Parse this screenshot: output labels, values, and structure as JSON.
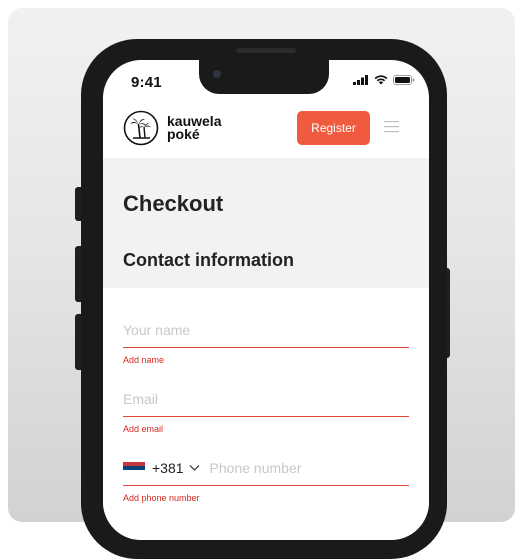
{
  "status_bar": {
    "time": "9:41"
  },
  "header": {
    "logo_line1": "kauwela",
    "logo_line2": "poké",
    "register_label": "Register"
  },
  "page": {
    "title": "Checkout",
    "section_title": "Contact information"
  },
  "form": {
    "name": {
      "placeholder": "Your name",
      "value": "",
      "error": "Add name"
    },
    "email": {
      "placeholder": "Email",
      "value": "",
      "error": "Add email"
    },
    "phone": {
      "country_flag": "serbia-flag",
      "dial_code": "+381",
      "placeholder": "Phone number",
      "value": "",
      "error": "Add phone number"
    }
  },
  "colors": {
    "accent": "#f05b3f",
    "error": "#d7281f",
    "section_bg": "#f2f2f2"
  }
}
